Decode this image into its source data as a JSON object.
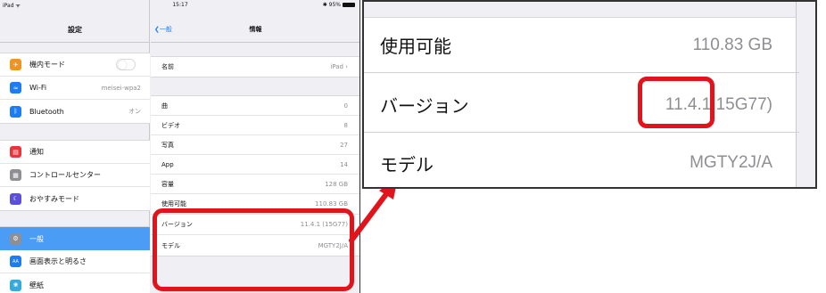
{
  "status_bar": {
    "device": "iPad ᯤ",
    "time": "15:17",
    "battery": "✱ 95%"
  },
  "sidebar": {
    "title": "設定",
    "items": [
      {
        "label": "機内モード",
        "icon": "airplane-icon",
        "color": "#f0941e",
        "glyph": "✈",
        "value": ""
      },
      {
        "label": "Wi-Fi",
        "icon": "wifi-icon",
        "color": "#1e7cf2",
        "glyph": "≈",
        "value": "meisei-wpa2"
      },
      {
        "label": "Bluetooth",
        "icon": "bluetooth-icon",
        "color": "#1e7cf2",
        "glyph": "ᛒ",
        "value": "オン"
      },
      {
        "label": "通知",
        "icon": "notifications-icon",
        "color": "#e8343a",
        "glyph": "▤",
        "value": ""
      },
      {
        "label": "コントロールセンター",
        "icon": "control-center-icon",
        "color": "#8e8e93",
        "glyph": "▦",
        "value": ""
      },
      {
        "label": "おやすみモード",
        "icon": "moon-icon",
        "color": "#5b51d8",
        "glyph": "☾",
        "value": ""
      },
      {
        "label": "一般",
        "icon": "gear-icon",
        "color": "#8e8e93",
        "glyph": "⚙",
        "value": ""
      },
      {
        "label": "画面表示と明るさ",
        "icon": "display-icon",
        "color": "#1e7cf2",
        "glyph": "AA",
        "value": ""
      },
      {
        "label": "壁紙",
        "icon": "wallpaper-icon",
        "color": "#35aadc",
        "glyph": "❀",
        "value": ""
      }
    ]
  },
  "detail": {
    "back_label": "一般",
    "title": "情報",
    "rows": [
      {
        "label": "名前",
        "value": "iPad ›"
      },
      {
        "label": "曲",
        "value": "0"
      },
      {
        "label": "ビデオ",
        "value": "8"
      },
      {
        "label": "写真",
        "value": "27"
      },
      {
        "label": "App",
        "value": "14"
      },
      {
        "label": "容量",
        "value": "128 GB"
      },
      {
        "label": "使用可能",
        "value": "110.83 GB"
      },
      {
        "label": "バージョン",
        "value": "11.4.1 (15G77)"
      },
      {
        "label": "モデル",
        "value": "MGTY2J/A"
      }
    ]
  },
  "zoom": {
    "rows": [
      {
        "label": "使用可能",
        "value": "110.83 GB"
      },
      {
        "label": "バージョン",
        "value": "11.4.1 15G77)"
      },
      {
        "label": "モデル",
        "value": "MGTY2J/A"
      }
    ]
  },
  "colors": {
    "highlight": "#e1141b",
    "selected": "#4b9cf5",
    "link": "#1e7cf2"
  }
}
